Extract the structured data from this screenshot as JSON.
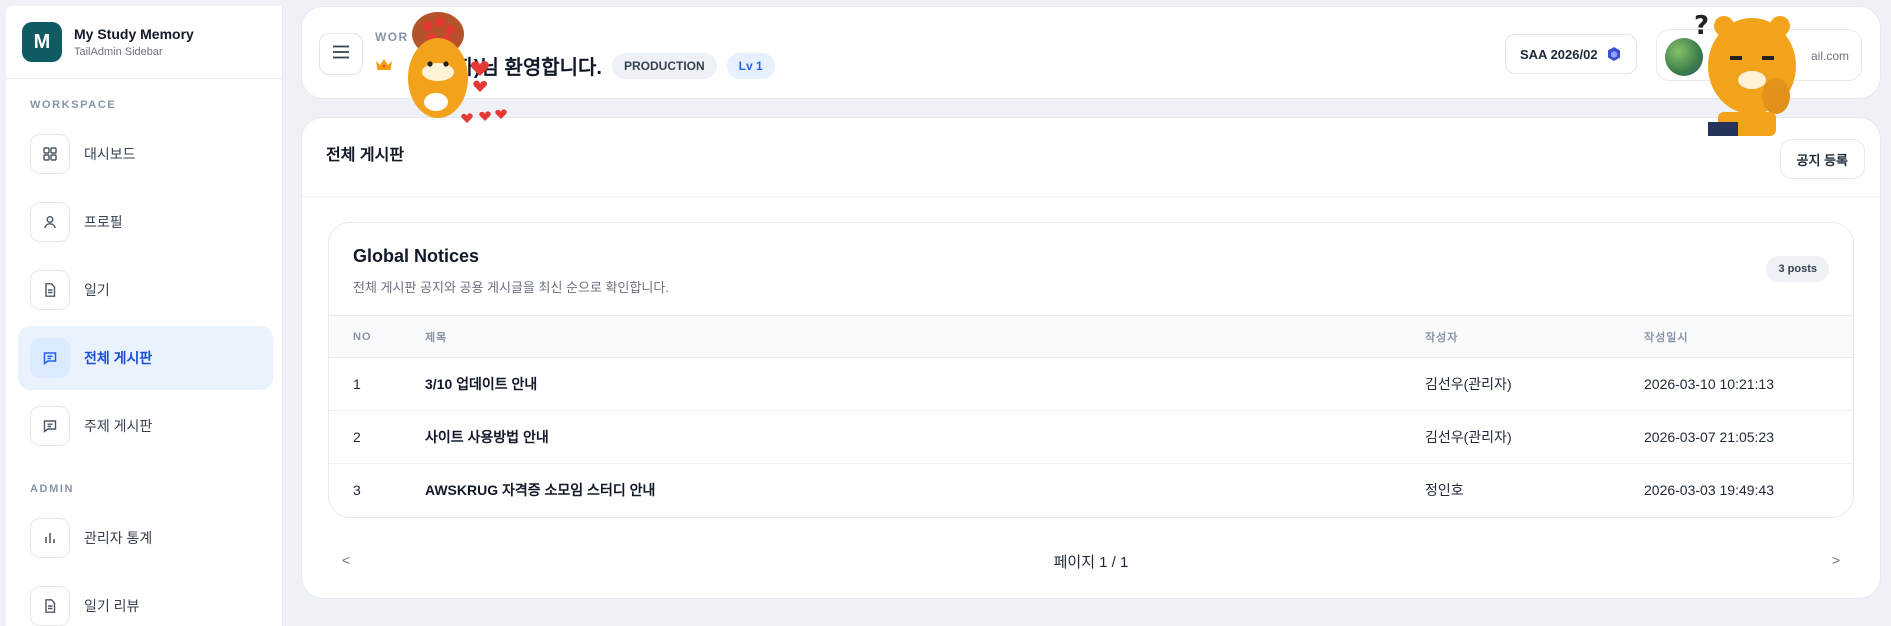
{
  "brand": {
    "logo_letter": "M",
    "title": "My Study Memory",
    "subtitle": "TailAdmin Sidebar"
  },
  "sidebar": {
    "workspace_label": "WORKSPACE",
    "admin_label": "ADMIN",
    "items": [
      {
        "label": "대시보드",
        "icon": "grid-icon",
        "active": false
      },
      {
        "label": "프로필",
        "icon": "user-icon",
        "active": false
      },
      {
        "label": "일기",
        "icon": "document-icon",
        "active": false
      },
      {
        "label": "전체 게시판",
        "icon": "chat-icon",
        "active": true
      },
      {
        "label": "주제 게시판",
        "icon": "chat-icon",
        "active": false
      },
      {
        "label": "관리자 통계",
        "icon": "bar-chart-icon",
        "active": false
      },
      {
        "label": "일기 리뷰",
        "icon": "document-icon",
        "active": false
      }
    ]
  },
  "header": {
    "workspace_label": "WOR",
    "welcome": "리자)님 환영합니다.",
    "env_badge": "PRODUCTION",
    "level_badge": "Lv 1",
    "cert_label": "SAA 2026/02",
    "email_partial": "ail.com"
  },
  "board": {
    "title": "전체 게시판",
    "notice_button": "공지 등록",
    "notices": {
      "title": "Global Notices",
      "subtitle": "전체 게시판 공지와 공용 게시글을 최신 순으로 확인합니다.",
      "count_badge": "3 posts"
    },
    "columns": [
      "NO",
      "제목",
      "작성자",
      "작성일시"
    ],
    "rows": [
      {
        "no": "1",
        "title": "3/10 업데이트 안내",
        "author": "김선우(관리자)",
        "date": "2026-03-10 10:21:13"
      },
      {
        "no": "2",
        "title": "사이트 사용방법 안내",
        "author": "김선우(관리자)",
        "date": "2026-03-07 21:05:23"
      },
      {
        "no": "3",
        "title": "AWSKRUG 자격증 소모임 스터디 안내",
        "author": "정인호",
        "date": "2026-03-03 19:49:43"
      }
    ],
    "pager": {
      "prev": "<",
      "label": "페이지 1 / 1",
      "next": ">"
    }
  },
  "colors": {
    "accent": "#2563eb",
    "brand": "#0f5b63",
    "active_bg": "#eaf3fd"
  }
}
